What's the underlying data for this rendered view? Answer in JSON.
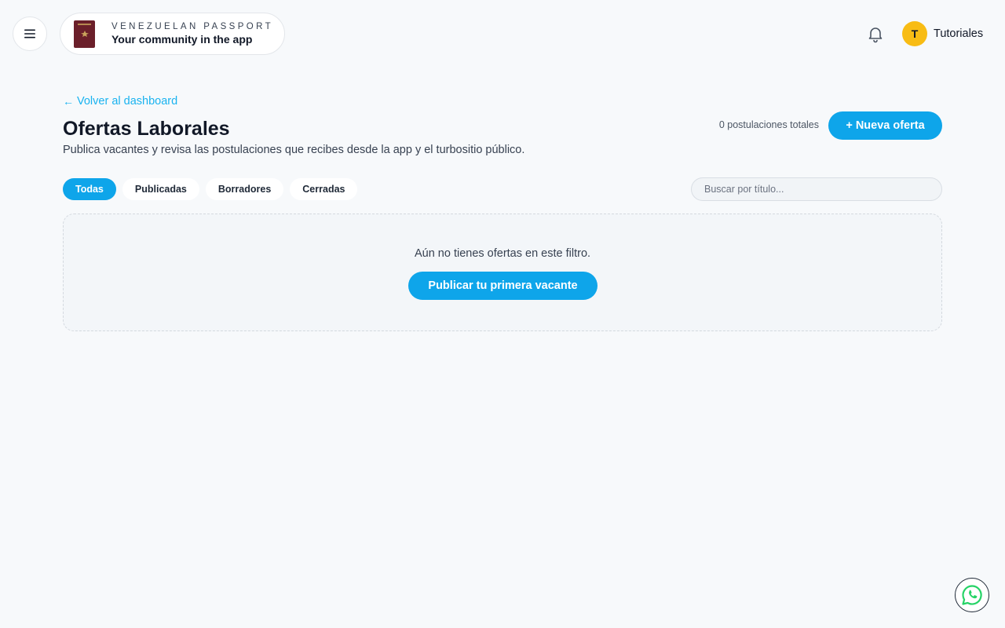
{
  "header": {
    "menu_icon": "hamburger-menu-icon",
    "brand": {
      "tagline": "VENEZUELAN PASSPORT",
      "subtitle": "Your community in the app",
      "logo_icon": "passport-icon"
    },
    "notifications_icon": "bell-icon",
    "user": {
      "initial": "T",
      "name": "Tutoriales",
      "avatar_color": "#f8bc14"
    }
  },
  "main": {
    "back_link": "Volver al dashboard",
    "title": "Ofertas Laborales",
    "description": "Publica vacantes y revisa las postulaciones que recibes desde la app y el turbositio público.",
    "total_applications": "0 postulaciones totales",
    "new_offer_label": "+ Nueva oferta",
    "filters": [
      {
        "label": "Todas",
        "active": true
      },
      {
        "label": "Publicadas",
        "active": false
      },
      {
        "label": "Borradores",
        "active": false
      },
      {
        "label": "Cerradas",
        "active": false
      }
    ],
    "search": {
      "placeholder": "Buscar por título...",
      "value": ""
    },
    "empty_state": {
      "message": "Aún no tienes ofertas en este filtro.",
      "button_label": "Publicar tu primera vacante"
    }
  },
  "floating": {
    "whatsapp_icon": "whatsapp-icon"
  },
  "colors": {
    "accent": "#0ea5ea",
    "link": "#19b3f0",
    "background": "#f7f9fb",
    "brand_passport": "#6b1f2a"
  }
}
